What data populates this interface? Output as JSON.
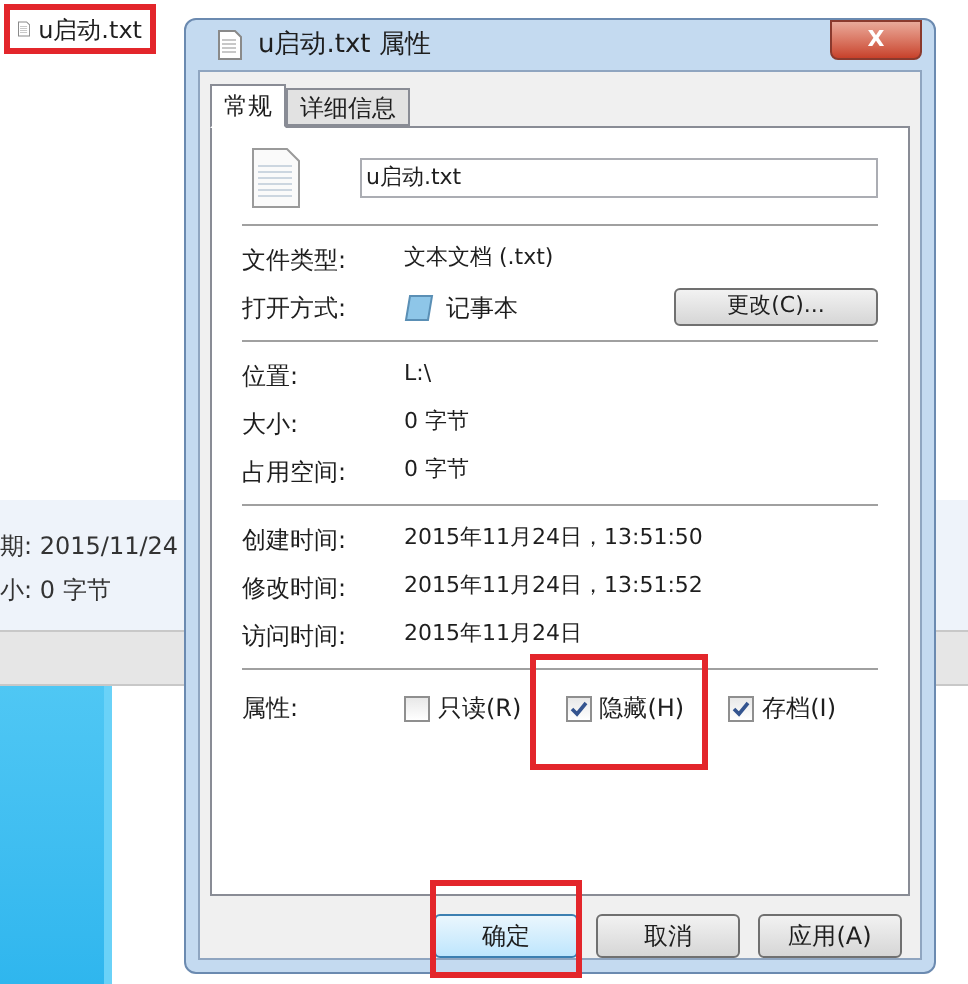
{
  "explorer": {
    "selected_file": "u启动.txt",
    "details": [
      {
        "text": "期: 2015/11/24"
      },
      {
        "text": "小: 0 字节"
      }
    ]
  },
  "dialog": {
    "title": "u启动.txt 属性",
    "close": "X",
    "tabs": [
      {
        "label": "常规",
        "selected": true
      },
      {
        "label": "详细信息",
        "selected": false
      }
    ],
    "file_name": "u启动.txt",
    "groups": [
      [
        {
          "label": "文件类型:",
          "value": "文本文档 (.txt)",
          "kind": "text"
        },
        {
          "label": "打开方式:",
          "value": "记事本",
          "kind": "app",
          "button": "更改(C)..."
        }
      ],
      [
        {
          "label": "位置:",
          "value": "L:\\",
          "kind": "text"
        },
        {
          "label": "大小:",
          "value": "0 字节",
          "kind": "text"
        },
        {
          "label": "占用空间:",
          "value": "0 字节",
          "kind": "text"
        }
      ],
      [
        {
          "label": "创建时间:",
          "value": "2015年11月24日，13:51:50",
          "kind": "text"
        },
        {
          "label": "修改时间:",
          "value": "2015年11月24日，13:51:52",
          "kind": "text"
        },
        {
          "label": "访问时间:",
          "value": "2015年11月24日",
          "kind": "text"
        }
      ]
    ],
    "attributes": {
      "label": "属性:",
      "items": [
        {
          "label": "只读(R)",
          "checked": false,
          "highlighted": false
        },
        {
          "label": "隐藏(H)",
          "checked": true,
          "highlighted": true
        },
        {
          "label": "存档(I)",
          "checked": true,
          "highlighted": false
        }
      ]
    },
    "buttons": [
      {
        "label": "确定",
        "highlighted": true
      },
      {
        "label": "取消",
        "highlighted": false
      },
      {
        "label": "应用(A)",
        "highlighted": false
      }
    ]
  }
}
